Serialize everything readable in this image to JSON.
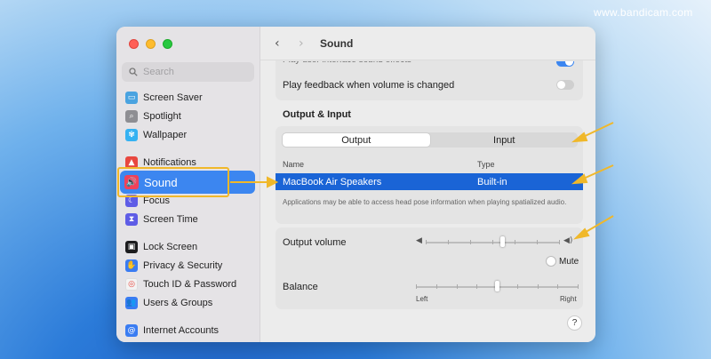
{
  "watermark": "www.bandicam.com",
  "window": {
    "title": "Sound",
    "search": {
      "placeholder": "Search"
    },
    "sidebar": {
      "items": [
        {
          "label": "Screen Saver",
          "icon": "screen-saver-icon",
          "color": "#4aa3e0"
        },
        {
          "label": "Spotlight",
          "icon": "spotlight-icon",
          "color": "#8e8e93"
        },
        {
          "label": "Wallpaper",
          "icon": "wallpaper-icon",
          "color": "#35b2f2"
        },
        {
          "label": "Notifications",
          "icon": "notifications-icon",
          "color": "#e8473f"
        },
        {
          "label": "Sound",
          "icon": "sound-icon",
          "color": "#f0415a",
          "active": true
        },
        {
          "label": "Focus",
          "icon": "focus-icon",
          "color": "#5e5ce6"
        },
        {
          "label": "Screen Time",
          "icon": "screen-time-icon",
          "color": "#5e5ce6"
        },
        {
          "label": "Lock Screen",
          "icon": "lock-screen-icon",
          "color": "#1c1c1e"
        },
        {
          "label": "Privacy & Security",
          "icon": "privacy-hand-icon",
          "color": "#3a7cf2"
        },
        {
          "label": "Touch ID & Password",
          "icon": "touch-id-icon",
          "color": "#f3f3f3"
        },
        {
          "label": "Users & Groups",
          "icon": "users-groups-icon",
          "color": "#3a7cf2"
        },
        {
          "label": "Internet Accounts",
          "icon": "internet-accounts-icon",
          "color": "#3a7cf2"
        }
      ]
    },
    "main": {
      "partial_row": "Play user interface sound effects",
      "feedback_row": "Play feedback when volume is changed",
      "section_title": "Output & Input",
      "tabs": {
        "output": "Output",
        "input": "Input"
      },
      "table": {
        "headers": [
          "Name",
          "Type"
        ],
        "rows": [
          {
            "name": "MacBook Air Speakers",
            "type": "Built-in"
          }
        ]
      },
      "note": "Applications may be able to access head pose information when playing spatialized audio.",
      "output_volume_label": "Output volume",
      "output_volume_level": 0.57,
      "mute_label": "Mute",
      "balance_label": "Balance",
      "balance_level": 0.5,
      "balance_left": "Left",
      "balance_right": "Right",
      "help": "?"
    }
  },
  "colors": {
    "accent": "#3c86f0",
    "selection": "#1a64d6",
    "annotation": "#f0b82a"
  }
}
